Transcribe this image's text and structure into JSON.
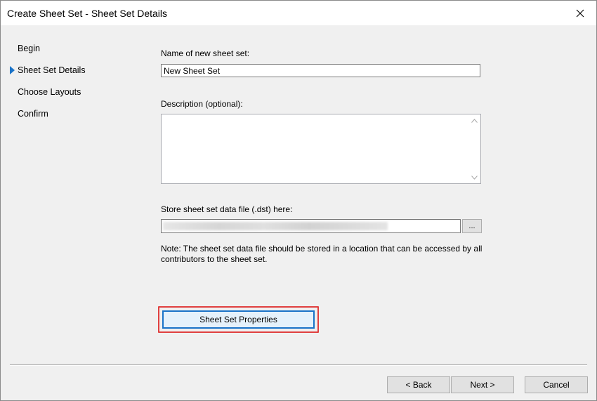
{
  "window": {
    "title": "Create Sheet Set - Sheet Set Details",
    "close_icon": "close-icon"
  },
  "steps": [
    {
      "label": "Begin",
      "active": false
    },
    {
      "label": "Sheet Set Details",
      "active": true
    },
    {
      "label": "Choose Layouts",
      "active": false
    },
    {
      "label": "Confirm",
      "active": false
    }
  ],
  "form": {
    "name_label": "Name of new sheet set:",
    "name_value": "New Sheet Set",
    "description_label": "Description (optional):",
    "description_value": "",
    "store_label": "Store sheet set data file (.dst) here:",
    "browse_label": "...",
    "note": "Note: The sheet set data file should be stored in a location that can be accessed by all contributors to the sheet set.",
    "properties_button": "Sheet Set Properties"
  },
  "footer": {
    "back": "< Back",
    "next": "Next >",
    "cancel": "Cancel"
  },
  "colors": {
    "accent": "#1a73c8",
    "highlight": "#e0403f",
    "background": "#f0f0f0"
  }
}
